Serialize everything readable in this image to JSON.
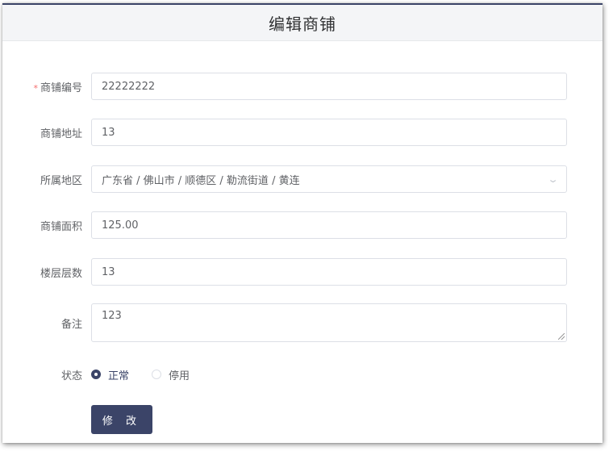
{
  "dialog": {
    "title": "编辑商铺"
  },
  "form": {
    "shop_code": {
      "label": "商铺编号",
      "required_mark": "*",
      "value": "22222222"
    },
    "shop_address": {
      "label": "商铺地址",
      "value": "13"
    },
    "region": {
      "label": "所属地区",
      "value": "广东省 / 佛山市 / 顺德区 / 勒流街道 / 黄连",
      "icon": "chevron-down-icon"
    },
    "shop_area": {
      "label": "商铺面积",
      "value": "125.00"
    },
    "floor_count": {
      "label": "楼层层数",
      "value": "13"
    },
    "remark": {
      "label": "备注",
      "value": "123"
    },
    "status": {
      "label": "状态",
      "options": [
        {
          "label": "正常",
          "checked": true
        },
        {
          "label": "停用",
          "checked": false
        }
      ]
    },
    "submit_label": "修 改"
  },
  "colors": {
    "primary": "#3b4468",
    "required": "#f56c6c",
    "border": "#dcdfe6",
    "header_bg": "#f4f5f7"
  }
}
